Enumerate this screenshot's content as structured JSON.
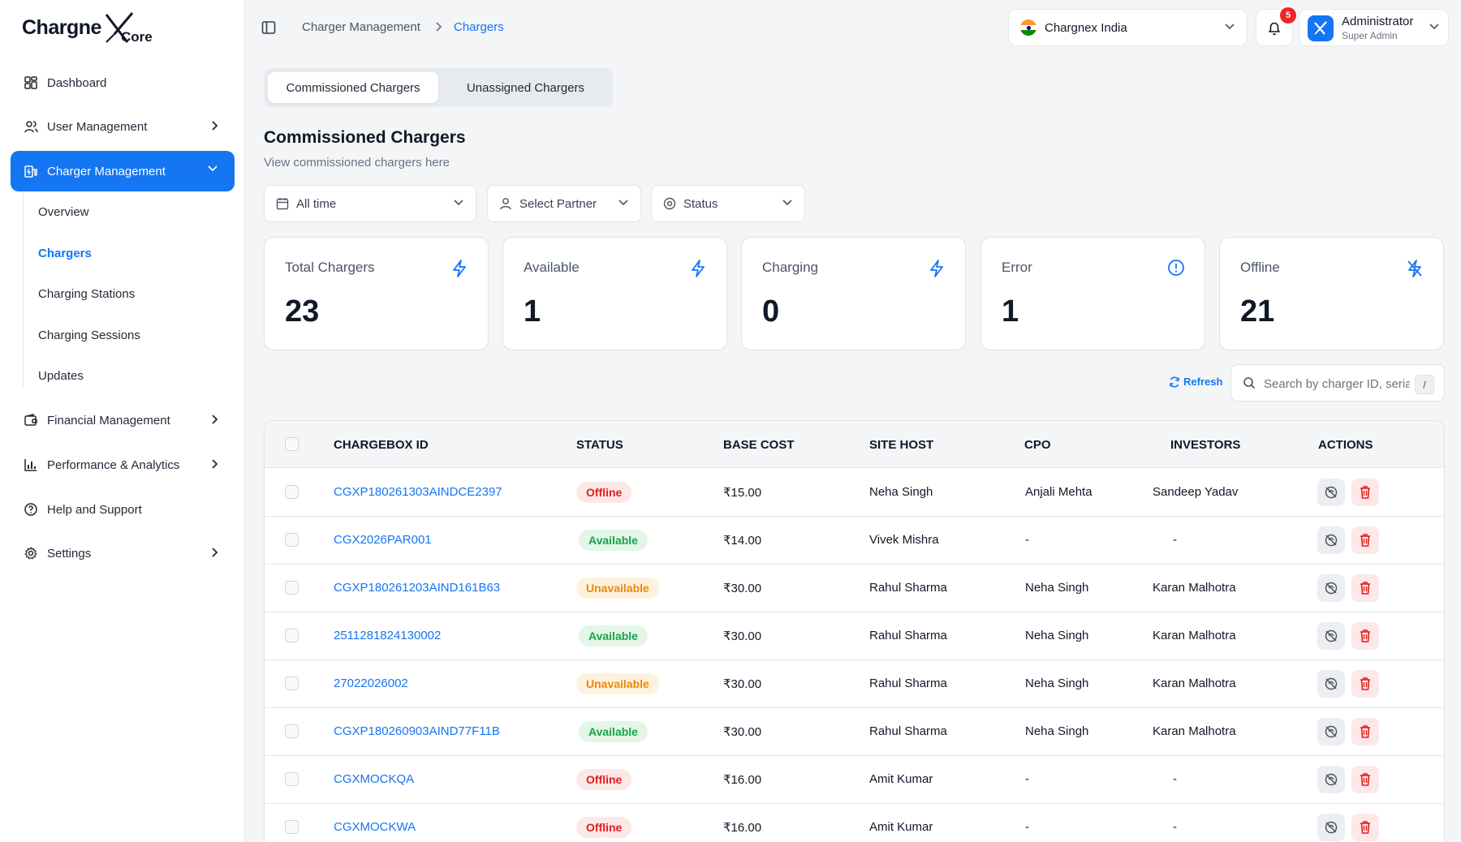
{
  "app": {
    "logo_word": "Chargne",
    "logo_sub": "Core"
  },
  "sidebar": {
    "items": [
      {
        "label": "Dashboard"
      },
      {
        "label": "User Management"
      },
      {
        "label": "Charger Management"
      },
      {
        "label": "Financial Management"
      },
      {
        "label": "Performance & Analytics"
      },
      {
        "label": "Help and Support"
      },
      {
        "label": "Settings"
      }
    ],
    "sub_items": [
      {
        "label": "Overview"
      },
      {
        "label": "Chargers"
      },
      {
        "label": "Charging Stations"
      },
      {
        "label": "Charging Sessions"
      },
      {
        "label": "Updates"
      }
    ]
  },
  "breadcrumb": {
    "parent": "Charger Management",
    "current": "Chargers"
  },
  "header": {
    "org": "Chargnex India",
    "notifications": "5",
    "user_name": "Administrator",
    "user_role": "Super Admin"
  },
  "tabs": [
    {
      "label": "Commissioned Chargers"
    },
    {
      "label": "Unassigned Chargers"
    }
  ],
  "page": {
    "title": "Commissioned Chargers",
    "subtitle": "View commissioned chargers here"
  },
  "filters": {
    "time": "All time",
    "partner": "Select Partner",
    "status": "Status"
  },
  "stats": [
    {
      "label": "Total Chargers",
      "value": "23"
    },
    {
      "label": "Available",
      "value": "1"
    },
    {
      "label": "Charging",
      "value": "0"
    },
    {
      "label": "Error",
      "value": "1"
    },
    {
      "label": "Offline",
      "value": "21"
    }
  ],
  "toolbar": {
    "refresh": "Refresh",
    "search_placeholder": "Search by charger ID, serial",
    "search_shortcut": "/"
  },
  "table": {
    "columns": [
      "CHARGEBOX ID",
      "STATUS",
      "BASE COST",
      "SITE HOST",
      "CPO",
      "INVESTORS",
      "ACTIONS"
    ],
    "rows": [
      {
        "id": "CGXP180261303AINDCE2397",
        "status": "Offline",
        "cost": "₹15.00",
        "host": "Neha Singh",
        "cpo": "Anjali Mehta",
        "investors": "Sandeep Yadav"
      },
      {
        "id": "CGX2026PAR001",
        "status": "Available",
        "cost": "₹14.00",
        "host": "Vivek Mishra",
        "cpo": "-",
        "investors": "-"
      },
      {
        "id": "CGXP180261203AIND161B63",
        "status": "Unavailable",
        "cost": "₹30.00",
        "host": "Rahul Sharma",
        "cpo": "Neha Singh",
        "investors": "Karan Malhotra"
      },
      {
        "id": "2511281824130002",
        "status": "Available",
        "cost": "₹30.00",
        "host": "Rahul Sharma",
        "cpo": "Neha Singh",
        "investors": "Karan Malhotra"
      },
      {
        "id": "27022026002",
        "status": "Unavailable",
        "cost": "₹30.00",
        "host": "Rahul Sharma",
        "cpo": "Neha Singh",
        "investors": "Karan Malhotra"
      },
      {
        "id": "CGXP180260903AIND77F11B",
        "status": "Available",
        "cost": "₹30.00",
        "host": "Rahul Sharma",
        "cpo": "Neha Singh",
        "investors": "Karan Malhotra"
      },
      {
        "id": "CGXMOCKQA",
        "status": "Offline",
        "cost": "₹16.00",
        "host": "Amit Kumar",
        "cpo": "-",
        "investors": "-"
      },
      {
        "id": "CGXMOCKWA",
        "status": "Offline",
        "cost": "₹16.00",
        "host": "Amit Kumar",
        "cpo": "-",
        "investors": "-"
      }
    ]
  }
}
